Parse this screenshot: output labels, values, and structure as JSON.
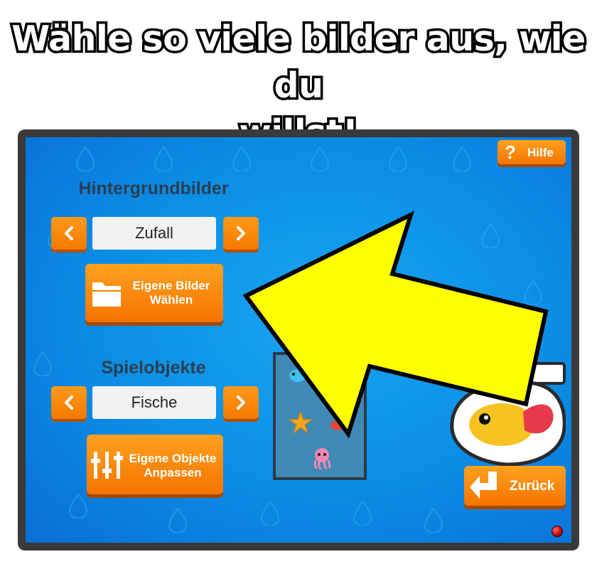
{
  "headline": {
    "line1": "Wähle so viele bilder aus, wie du",
    "line2": "willst!"
  },
  "help_button": {
    "label": "Hilfe",
    "icon": "question-icon"
  },
  "backgrounds": {
    "title": "Hintergrundbilder",
    "selected": "Zufall",
    "custom_button_line1": "Eigene Bilder",
    "custom_button_line2": "Wählen",
    "custom_button_icon": "folder-icon"
  },
  "game_objects": {
    "title": "Spielobjekte",
    "selected": "Fische",
    "custom_button_line1": "Eigene Objekte",
    "custom_button_line2": "Anpassen",
    "custom_button_icon": "sliders-icon"
  },
  "back_button": {
    "label": "Zurück",
    "icon": "return-arrow-icon"
  },
  "colors": {
    "button_orange": "#f47a00",
    "screen_blue": "#0b8fe6",
    "highlight_arrow": "#ffff00",
    "status_led": "#c00000"
  }
}
